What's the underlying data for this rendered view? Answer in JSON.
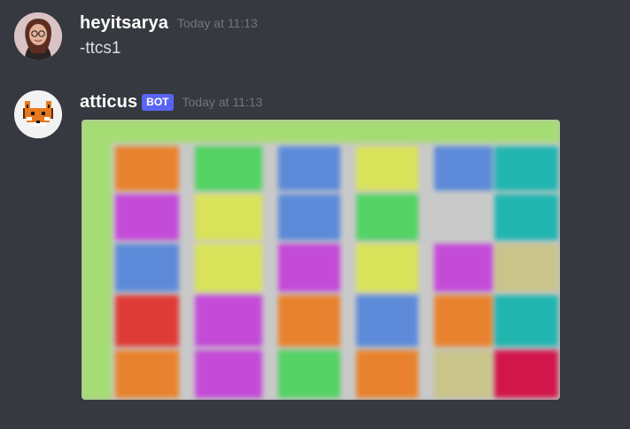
{
  "messages": [
    {
      "username": "heyitsarya",
      "timestamp": "Today at 11:13",
      "content": "-ttcs1",
      "avatar_icon": "user-avatar-icon"
    },
    {
      "username": "atticus",
      "bot_tag": "BOT",
      "timestamp": "Today at 11:13",
      "avatar_icon": "fox-avatar-icon",
      "attachment": {
        "kind": "timetable-image",
        "blurred": true,
        "palette": {
          "header": "#a6dc74",
          "gap": "#c9c9c9",
          "orange": "#e8822e",
          "green": "#54d263",
          "blue": "#5c8ad8",
          "yellow": "#d9e35a",
          "cyan": "#21b5b0",
          "purple": "#c44bd8",
          "khaki": "#c9c48a",
          "red": "#df3b36",
          "magenta": "#d2164b"
        }
      }
    }
  ]
}
